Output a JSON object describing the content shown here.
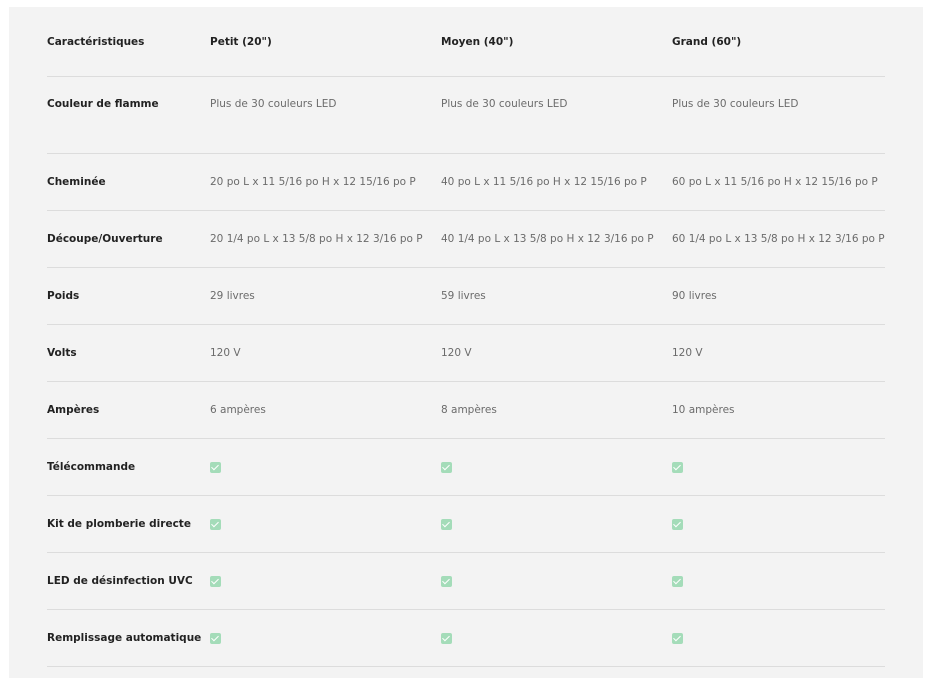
{
  "columns": [
    "Caractéristiques",
    "Petit (20\")",
    "Moyen (40\")",
    "Grand (60\")"
  ],
  "rows": [
    {
      "label": "Couleur de flamme",
      "values": [
        "Plus de 30 couleurs LED",
        "Plus de 30 couleurs LED",
        "Plus de 30 couleurs LED"
      ]
    },
    {
      "label": "Cheminée",
      "values": [
        "20 po L x 11 5/16 po H x 12 15/16 po P",
        "40 po L x 11 5/16 po H x 12 15/16 po P",
        "60 po L x 11 5/16 po H x 12 15/16 po P"
      ]
    },
    {
      "label": "Découpe/Ouverture",
      "values": [
        "20 1/4 po L x 13 5/8 po H x 12 3/16 po P",
        "40 1/4 po L x 13 5/8 po H x 12 3/16 po P",
        "60 1/4 po L x 13 5/8 po H x 12 3/16 po P"
      ]
    },
    {
      "label": "Poids",
      "values": [
        "29 livres",
        "59 livres",
        "90 livres"
      ]
    },
    {
      "label": "Volts",
      "values": [
        "120 V",
        "120 V",
        "120 V"
      ]
    },
    {
      "label": "Ampères",
      "values": [
        "6 ampères",
        "8 ampères",
        "10 ampères"
      ]
    },
    {
      "label": "Télécommande",
      "included": [
        true,
        true,
        true
      ]
    },
    {
      "label": "Kit de plomberie directe",
      "included": [
        true,
        true,
        true
      ]
    },
    {
      "label": "LED de désinfection UVC",
      "included": [
        true,
        true,
        true
      ]
    },
    {
      "label": "Remplissage automatique",
      "included": [
        true,
        true,
        true
      ]
    }
  ],
  "colors": {
    "check_icon": "#a4dcb9",
    "panel_background": "#f3f3f3",
    "divider": "#dcdcdc"
  },
  "icons": {
    "included": "checkbox-checked-icon"
  }
}
